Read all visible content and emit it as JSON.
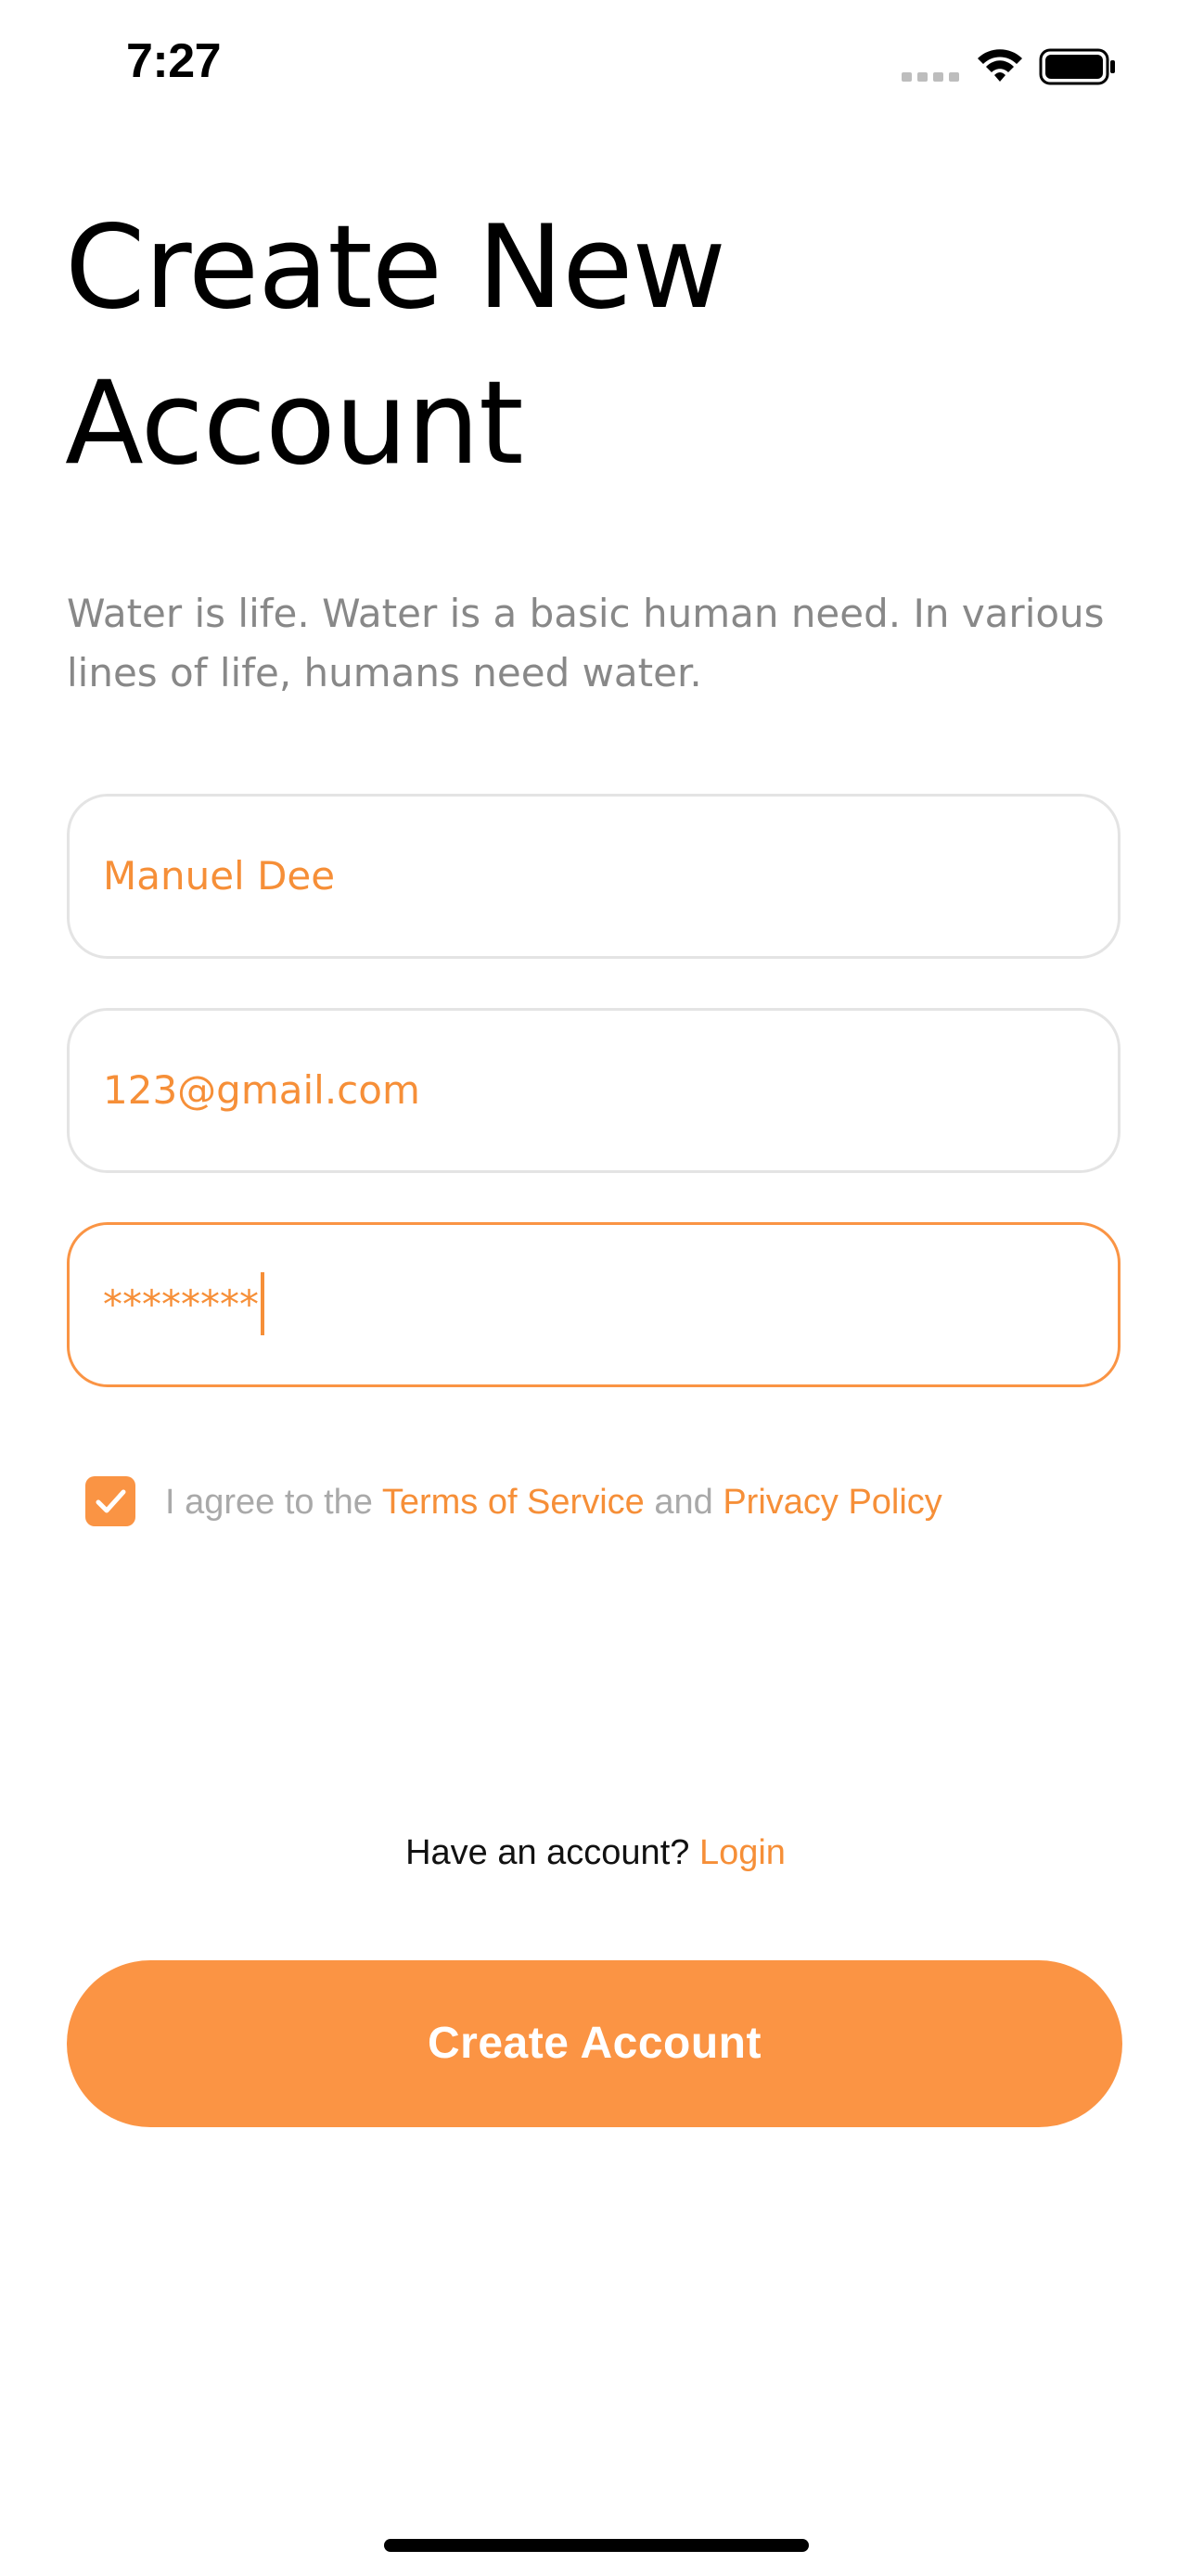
{
  "status_bar": {
    "time": "7:27",
    "icons": [
      "signal-icon",
      "wifi-icon",
      "battery-icon"
    ]
  },
  "header": {
    "title_line1": "Create New",
    "title_line2": "Account",
    "subtitle": "Water is life. Water is a basic human need. In various lines of life, humans need water."
  },
  "form": {
    "name_value": "Manuel Dee",
    "email_value": "123@gmail.com",
    "password_value": "********",
    "agree": {
      "checked": true,
      "prefix": "I agree to the ",
      "terms_label": "Terms of Service",
      "middle": " and ",
      "privacy_label": "Privacy Policy"
    }
  },
  "footer": {
    "have_account_text": "Have an account? ",
    "login_label": "Login",
    "create_button_label": "Create Account"
  },
  "colors": {
    "accent": "#fb9444",
    "text_primary": "#000000",
    "text_muted": "#888888",
    "field_border": "#e4e4e4"
  }
}
